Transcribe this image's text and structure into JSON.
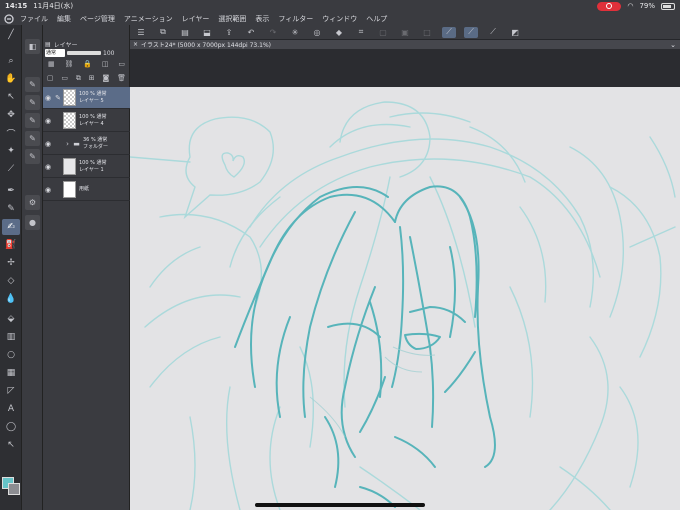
{
  "status": {
    "time": "14:15",
    "date": "11月4日(水)",
    "battery": "79%"
  },
  "menu": [
    "ファイル",
    "編集",
    "ページ管理",
    "アニメーション",
    "レイヤー",
    "選択範囲",
    "表示",
    "フィルター",
    "ウィンドウ",
    "ヘルプ"
  ],
  "layer_panel": {
    "tab": "レイヤー",
    "blend_mode": "通常",
    "opacity": "100",
    "layers": [
      {
        "line1": "100 % 通常",
        "line2": "レイヤー 5",
        "selected": true
      },
      {
        "line1": "100 % 通常",
        "line2": "レイヤー 4",
        "selected": false
      },
      {
        "line1": "36 % 通常",
        "line2": "フォルダー",
        "selected": false
      },
      {
        "line1": "100 % 通常",
        "line2": "レイヤー 1",
        "selected": false
      },
      {
        "line1": "",
        "line2": "用紙",
        "selected": false
      }
    ]
  },
  "document_tab": "イラスト24* (5000 x 7000px 144dpi 73.1%)",
  "colors": {
    "main": "#66c3c8",
    "sub": "#8c8d92",
    "accent": "#5b6c88",
    "stroke": "#57b4ba",
    "sketch": "#a5d9da"
  },
  "icons": {
    "tools": [
      "brush-size-icon",
      "zoom-icon",
      "hand-icon",
      "move-icon",
      "operation-icon",
      "lasso-icon",
      "magic-wand-icon",
      "eyedropper-icon",
      "pen-icon",
      "pencil-icon",
      "brush-icon",
      "airbrush-icon",
      "decoration-icon",
      "eraser-icon",
      "blend-icon",
      "fill-icon",
      "gradient-icon",
      "shape-icon",
      "frame-icon",
      "ruler-icon",
      "text-icon",
      "balloon-icon",
      "correct-line-icon"
    ]
  }
}
